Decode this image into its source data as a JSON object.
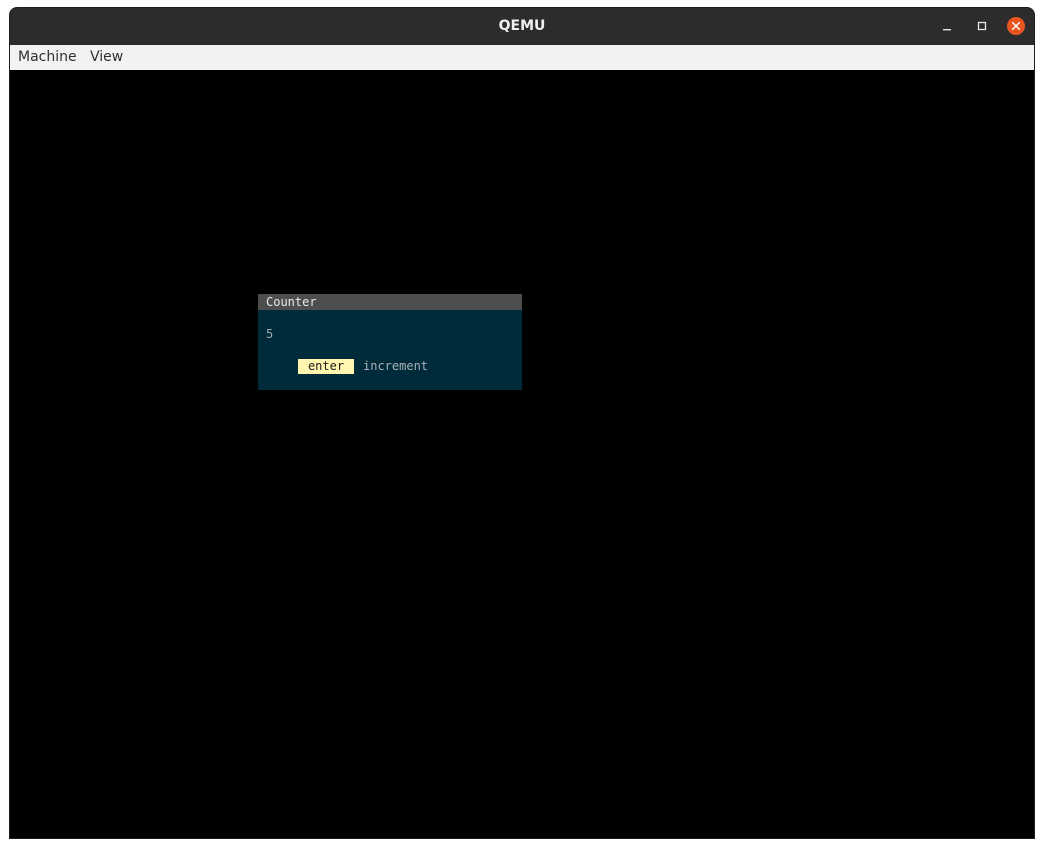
{
  "window": {
    "title": "QEMU"
  },
  "menubar": {
    "items": [
      {
        "label": "Machine"
      },
      {
        "label": "View"
      }
    ]
  },
  "window_controls": {
    "minimize_icon": "minimize-icon",
    "maximize_icon": "maximize-icon",
    "close_icon": "close-icon",
    "close_color": "#e95420"
  },
  "guest": {
    "dialog": {
      "title": "Counter",
      "value": "5",
      "shortcut": {
        "key": "enter",
        "action": "increment"
      },
      "colors": {
        "body": "#002b3a",
        "title_bar": "#4e4e4e",
        "key_badge": "#fff6b0"
      }
    }
  }
}
